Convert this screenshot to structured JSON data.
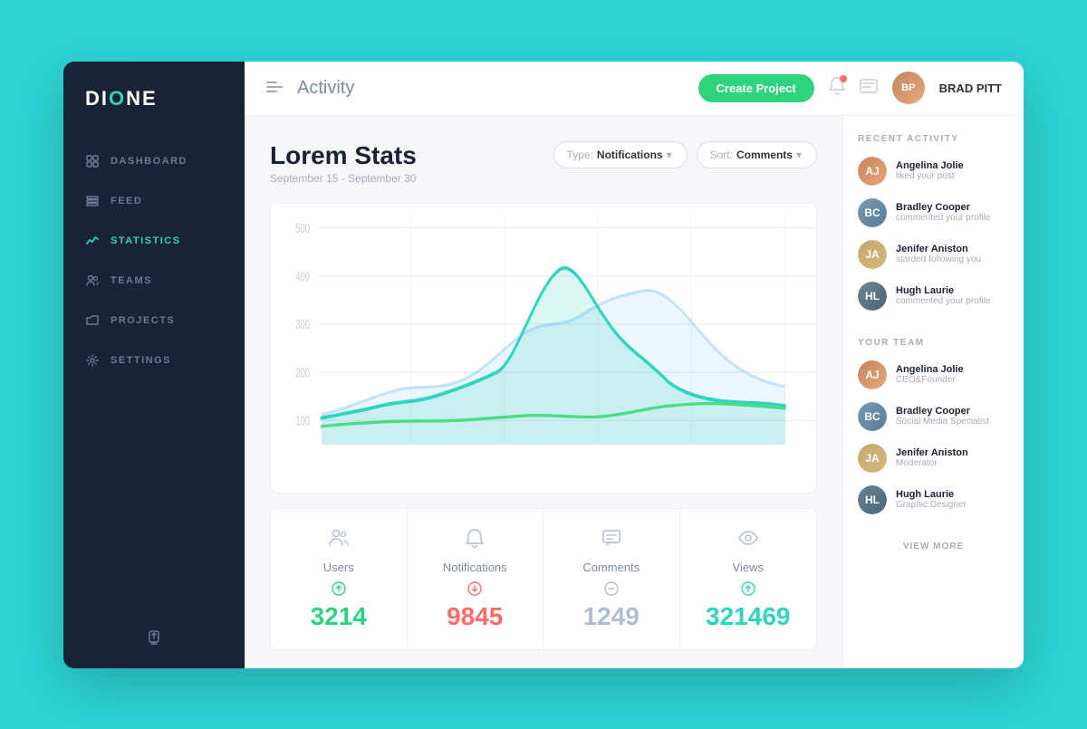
{
  "sidebar": {
    "logo": {
      "text1": "DI",
      "text2": "ONE"
    },
    "nav": [
      {
        "id": "dashboard",
        "label": "Dashboard",
        "icon": "grid"
      },
      {
        "id": "feed",
        "label": "Feed",
        "icon": "layers"
      },
      {
        "id": "statistics",
        "label": "Statistics",
        "icon": "chart",
        "active": true
      },
      {
        "id": "teams",
        "label": "Teams",
        "icon": "users"
      },
      {
        "id": "projects",
        "label": "Projects",
        "icon": "folder"
      },
      {
        "id": "settings",
        "label": "Settings",
        "icon": "gear"
      }
    ],
    "footer_icon": "share"
  },
  "header": {
    "title": "Activity",
    "btn_create": "Create Project",
    "user_name": "BRAD PITT"
  },
  "page": {
    "stats_title": "Lorem Stats",
    "stats_date": "September 15 - September 30",
    "type_label": "Type:",
    "type_value": "Notifications",
    "sort_label": "Sort:",
    "sort_value": "Comments"
  },
  "stat_cards": [
    {
      "id": "users",
      "label": "Users",
      "value": "3214",
      "trend": "up",
      "color": "green"
    },
    {
      "id": "notifications",
      "label": "Notifications",
      "value": "9845",
      "trend": "down",
      "color": "red"
    },
    {
      "id": "comments",
      "label": "Comments",
      "value": "1249",
      "trend": "neutral",
      "color": "gray"
    },
    {
      "id": "views",
      "label": "Views",
      "value": "321469",
      "trend": "up",
      "color": "teal"
    }
  ],
  "recent_activity": {
    "title": "Recent Activity",
    "items": [
      {
        "name": "Angelina Jolie",
        "action": "liked your post",
        "avatar": "av1",
        "initials": "AJ"
      },
      {
        "name": "Bradley Cooper",
        "action": "commented your profile",
        "avatar": "av2",
        "initials": "BC"
      },
      {
        "name": "Jenifer Aniston",
        "action": "starded following you",
        "avatar": "av3",
        "initials": "JA"
      },
      {
        "name": "Hugh Laurie",
        "action": "commented your profile",
        "avatar": "av4",
        "initials": "HL"
      }
    ]
  },
  "your_team": {
    "title": "Your Team",
    "items": [
      {
        "name": "Angelina Jolie",
        "role": "CEO&Founder",
        "avatar": "av1",
        "initials": "AJ"
      },
      {
        "name": "Bradley Cooper",
        "role": "Social Media Specialist",
        "avatar": "av2",
        "initials": "BC"
      },
      {
        "name": "Jenifer Aniston",
        "role": "Moderator",
        "avatar": "av3",
        "initials": "JA"
      },
      {
        "name": "Hugh Laurie",
        "role": "Graphic Designer",
        "avatar": "av4",
        "initials": "HL"
      }
    ],
    "view_more": "View More"
  }
}
